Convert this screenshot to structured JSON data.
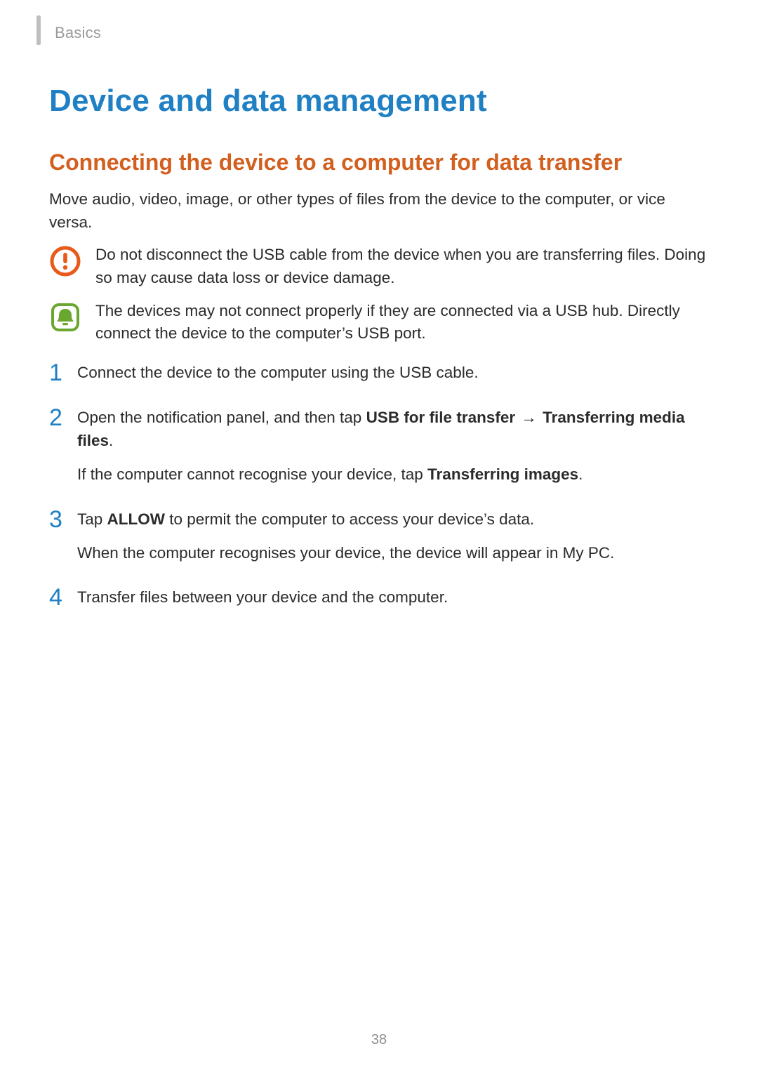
{
  "header": {
    "section_label": "Basics"
  },
  "title": "Device and data management",
  "section_heading": "Connecting the device to a computer for data transfer",
  "intro": "Move audio, video, image, or other types of files from the device to the computer, or vice versa.",
  "callouts": {
    "caution": "Do not disconnect the USB cable from the device when you are transferring files. Doing so may cause data loss or device damage.",
    "note": "The devices may not connect properly if they are connected via a USB hub. Directly connect the device to the computer’s USB port."
  },
  "steps": {
    "s1": "Connect the device to the computer using the USB cable.",
    "s2_pre": "Open the notification panel, and then tap ",
    "s2_b1": "USB for file transfer",
    "s2_arrow": " → ",
    "s2_b2": "Transferring media files",
    "s2_post": ".",
    "s2_sub_pre": "If the computer cannot recognise your device, tap ",
    "s2_sub_b": "Transferring images",
    "s2_sub_post": ".",
    "s3_pre": "Tap ",
    "s3_b": "ALLOW",
    "s3_post": " to permit the computer to access your device’s data.",
    "s3_sub": "When the computer recognises your device, the device will appear in My PC.",
    "s4": "Transfer files between your device and the computer."
  },
  "page_number": "38",
  "colors": {
    "title_blue": "#1f80c4",
    "heading_orange": "#d35f1f",
    "caution_orange": "#e85a1a",
    "note_green": "#6aa72f"
  }
}
